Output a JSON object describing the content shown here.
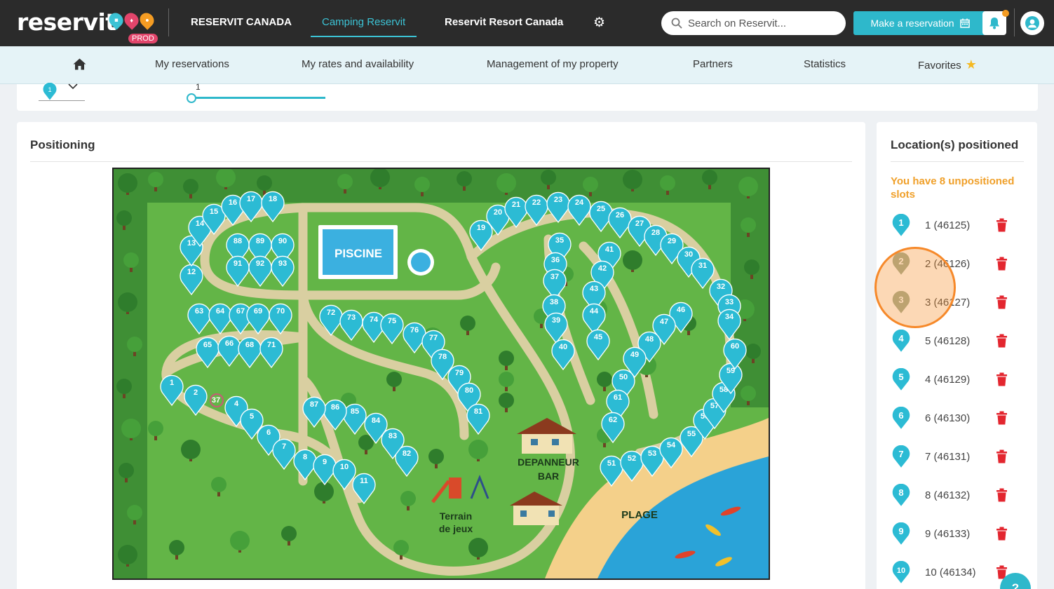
{
  "brand": {
    "logo_text": "reservit",
    "env_badge": "PROD"
  },
  "topnav": {
    "items": [
      "RESERVIT CANADA",
      "Camping Reservit",
      "Reservit Resort Canada"
    ],
    "active": "Camping Reservit"
  },
  "search": {
    "placeholder": "Search on Reservit..."
  },
  "make_reservation_label": "Make a reservation",
  "subnav": {
    "items": [
      "My reservations",
      "My rates and availability",
      "Management of my property",
      "Partners",
      "Statistics",
      "Favorites"
    ]
  },
  "filter_strip": {
    "selected_pin": "1",
    "slider_value": "1"
  },
  "positioning": {
    "title": "Positioning",
    "map": {
      "labels": [
        "PISCINE",
        "DEPANNEUR",
        "BAR",
        "Terrain",
        "de jeux",
        "PLAGE"
      ],
      "markers": [
        "1",
        "2",
        "4",
        "5",
        "6",
        "7",
        "8",
        "9",
        "10",
        "11",
        "12",
        "13",
        "14",
        "15",
        "16",
        "17",
        "18",
        "19",
        "20",
        "21",
        "22",
        "23",
        "24",
        "25",
        "26",
        "27",
        "28",
        "29",
        "30",
        "31",
        "32",
        "33",
        "34",
        "35",
        "36",
        "37",
        "38",
        "39",
        "40",
        "41",
        "42",
        "43",
        "44",
        "45",
        "46",
        "47",
        "48",
        "49",
        "50",
        "51",
        "52",
        "53",
        "54",
        "55",
        "56",
        "57",
        "58",
        "59",
        "60",
        "61",
        "62",
        "63",
        "64",
        "65",
        "66",
        "67",
        "68",
        "69",
        "70",
        "71",
        "72",
        "73",
        "74",
        "75",
        "76",
        "77",
        "78",
        "79",
        "80",
        "81",
        "82",
        "83",
        "84",
        "85",
        "86",
        "87",
        "88",
        "89",
        "90",
        "91",
        "92",
        "93"
      ],
      "unplaced_label": "37"
    }
  },
  "locations": {
    "title": "Location(s) positioned",
    "unpositioned_message": "You have 8 unpositioned slots",
    "rows": [
      {
        "badge": "1",
        "label": "1 (46125)",
        "faded": false
      },
      {
        "badge": "2",
        "label": "2 (46126)",
        "faded": true
      },
      {
        "badge": "3",
        "label": "3 (46127)",
        "faded": true
      },
      {
        "badge": "4",
        "label": "5 (46128)",
        "faded": false
      },
      {
        "badge": "5",
        "label": "4 (46129)",
        "faded": false
      },
      {
        "badge": "6",
        "label": "6 (46130)",
        "faded": false
      },
      {
        "badge": "7",
        "label": "7 (46131)",
        "faded": false
      },
      {
        "badge": "8",
        "label": "8 (46132)",
        "faded": false
      },
      {
        "badge": "9",
        "label": "9 (46133)",
        "faded": false
      },
      {
        "badge": "10",
        "label": "10 (46134)",
        "faded": false
      }
    ]
  },
  "help_label": "?",
  "colors": {
    "accent": "#2eb8cb",
    "marker": "#2cbbd4",
    "warning": "#f0a02a",
    "delete": "#e3262f",
    "topbar": "#2b2b2b",
    "grass": "#63b547",
    "water": "#2aa3d8",
    "sand": "#f4d08a"
  },
  "icons": [
    "search-icon",
    "calendar-icon",
    "bell-icon",
    "user-icon",
    "gear-icon",
    "home-icon",
    "star-icon",
    "trash-icon",
    "chevron-down-icon",
    "map-pin-icon"
  ]
}
